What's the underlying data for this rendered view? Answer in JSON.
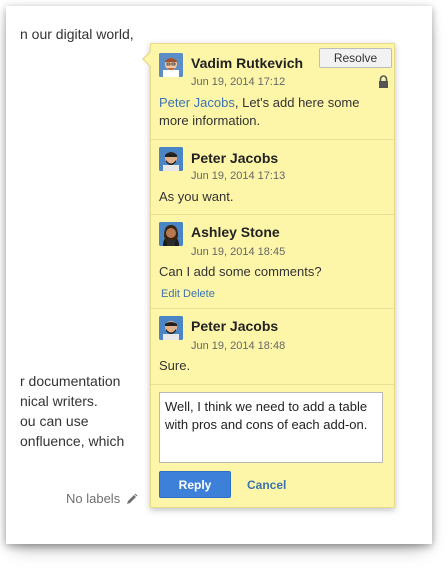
{
  "background": {
    "doc_line_1": "n our digital world,",
    "doc_fragments": [
      "r documentation",
      "nical writers.",
      "ou can use",
      "onfluence, which"
    ],
    "labels_text": "No labels"
  },
  "popup": {
    "resolve_label": "Resolve",
    "comments": [
      {
        "author": "Vadim Rutkevich",
        "time": "Jun 19, 2014 17:12",
        "mention": "Peter Jacobs",
        "text": ", Let's add here some more information."
      },
      {
        "author": "Peter Jacobs",
        "time": "Jun 19, 2014 17:13",
        "text": "As you want."
      },
      {
        "author": "Ashley Stone",
        "time": "Jun 19, 2014 18:45",
        "text": "Can I add some comments?",
        "edit_label": "Edit",
        "delete_label": "Delete"
      },
      {
        "author": "Peter Jacobs",
        "time": "Jun 19, 2014 18:48",
        "text": "Sure."
      }
    ],
    "reply_text": "Well, I think we need to add a table with pros and cons of each add-on.",
    "reply_button": "Reply",
    "cancel_button": "Cancel"
  },
  "colors": {
    "popup_bg": "#fdf6a9",
    "accent": "#3d80da",
    "link": "#3b73af"
  },
  "icons": [
    "avatar-vadim",
    "avatar-peter",
    "avatar-ashley",
    "lock-icon",
    "pencil-icon"
  ]
}
